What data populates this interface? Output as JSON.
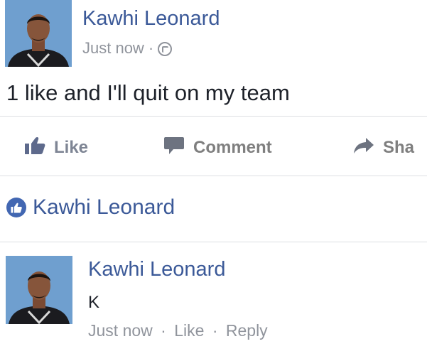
{
  "post": {
    "author": "Kawhi Leonard",
    "timestamp": "Just now",
    "separator": "·",
    "privacy_icon": "globe-icon",
    "text": "1 like and I'll quit on my team"
  },
  "actions": {
    "like_label": "Like",
    "comment_label": "Comment",
    "share_label": "Sha"
  },
  "likes": {
    "liker": "Kawhi Leonard",
    "icon": "thumbs-up-icon"
  },
  "reply": {
    "author": "Kawhi Leonard",
    "text": "K",
    "timestamp": "Just now",
    "separator": "·",
    "like_label": "Like",
    "reply_label": "Reply"
  },
  "colors": {
    "name_blue": "#3b5998",
    "meta_gray": "#90949c",
    "avatar_bg": "#6f9fcf",
    "like_badge": "#4267b2"
  }
}
